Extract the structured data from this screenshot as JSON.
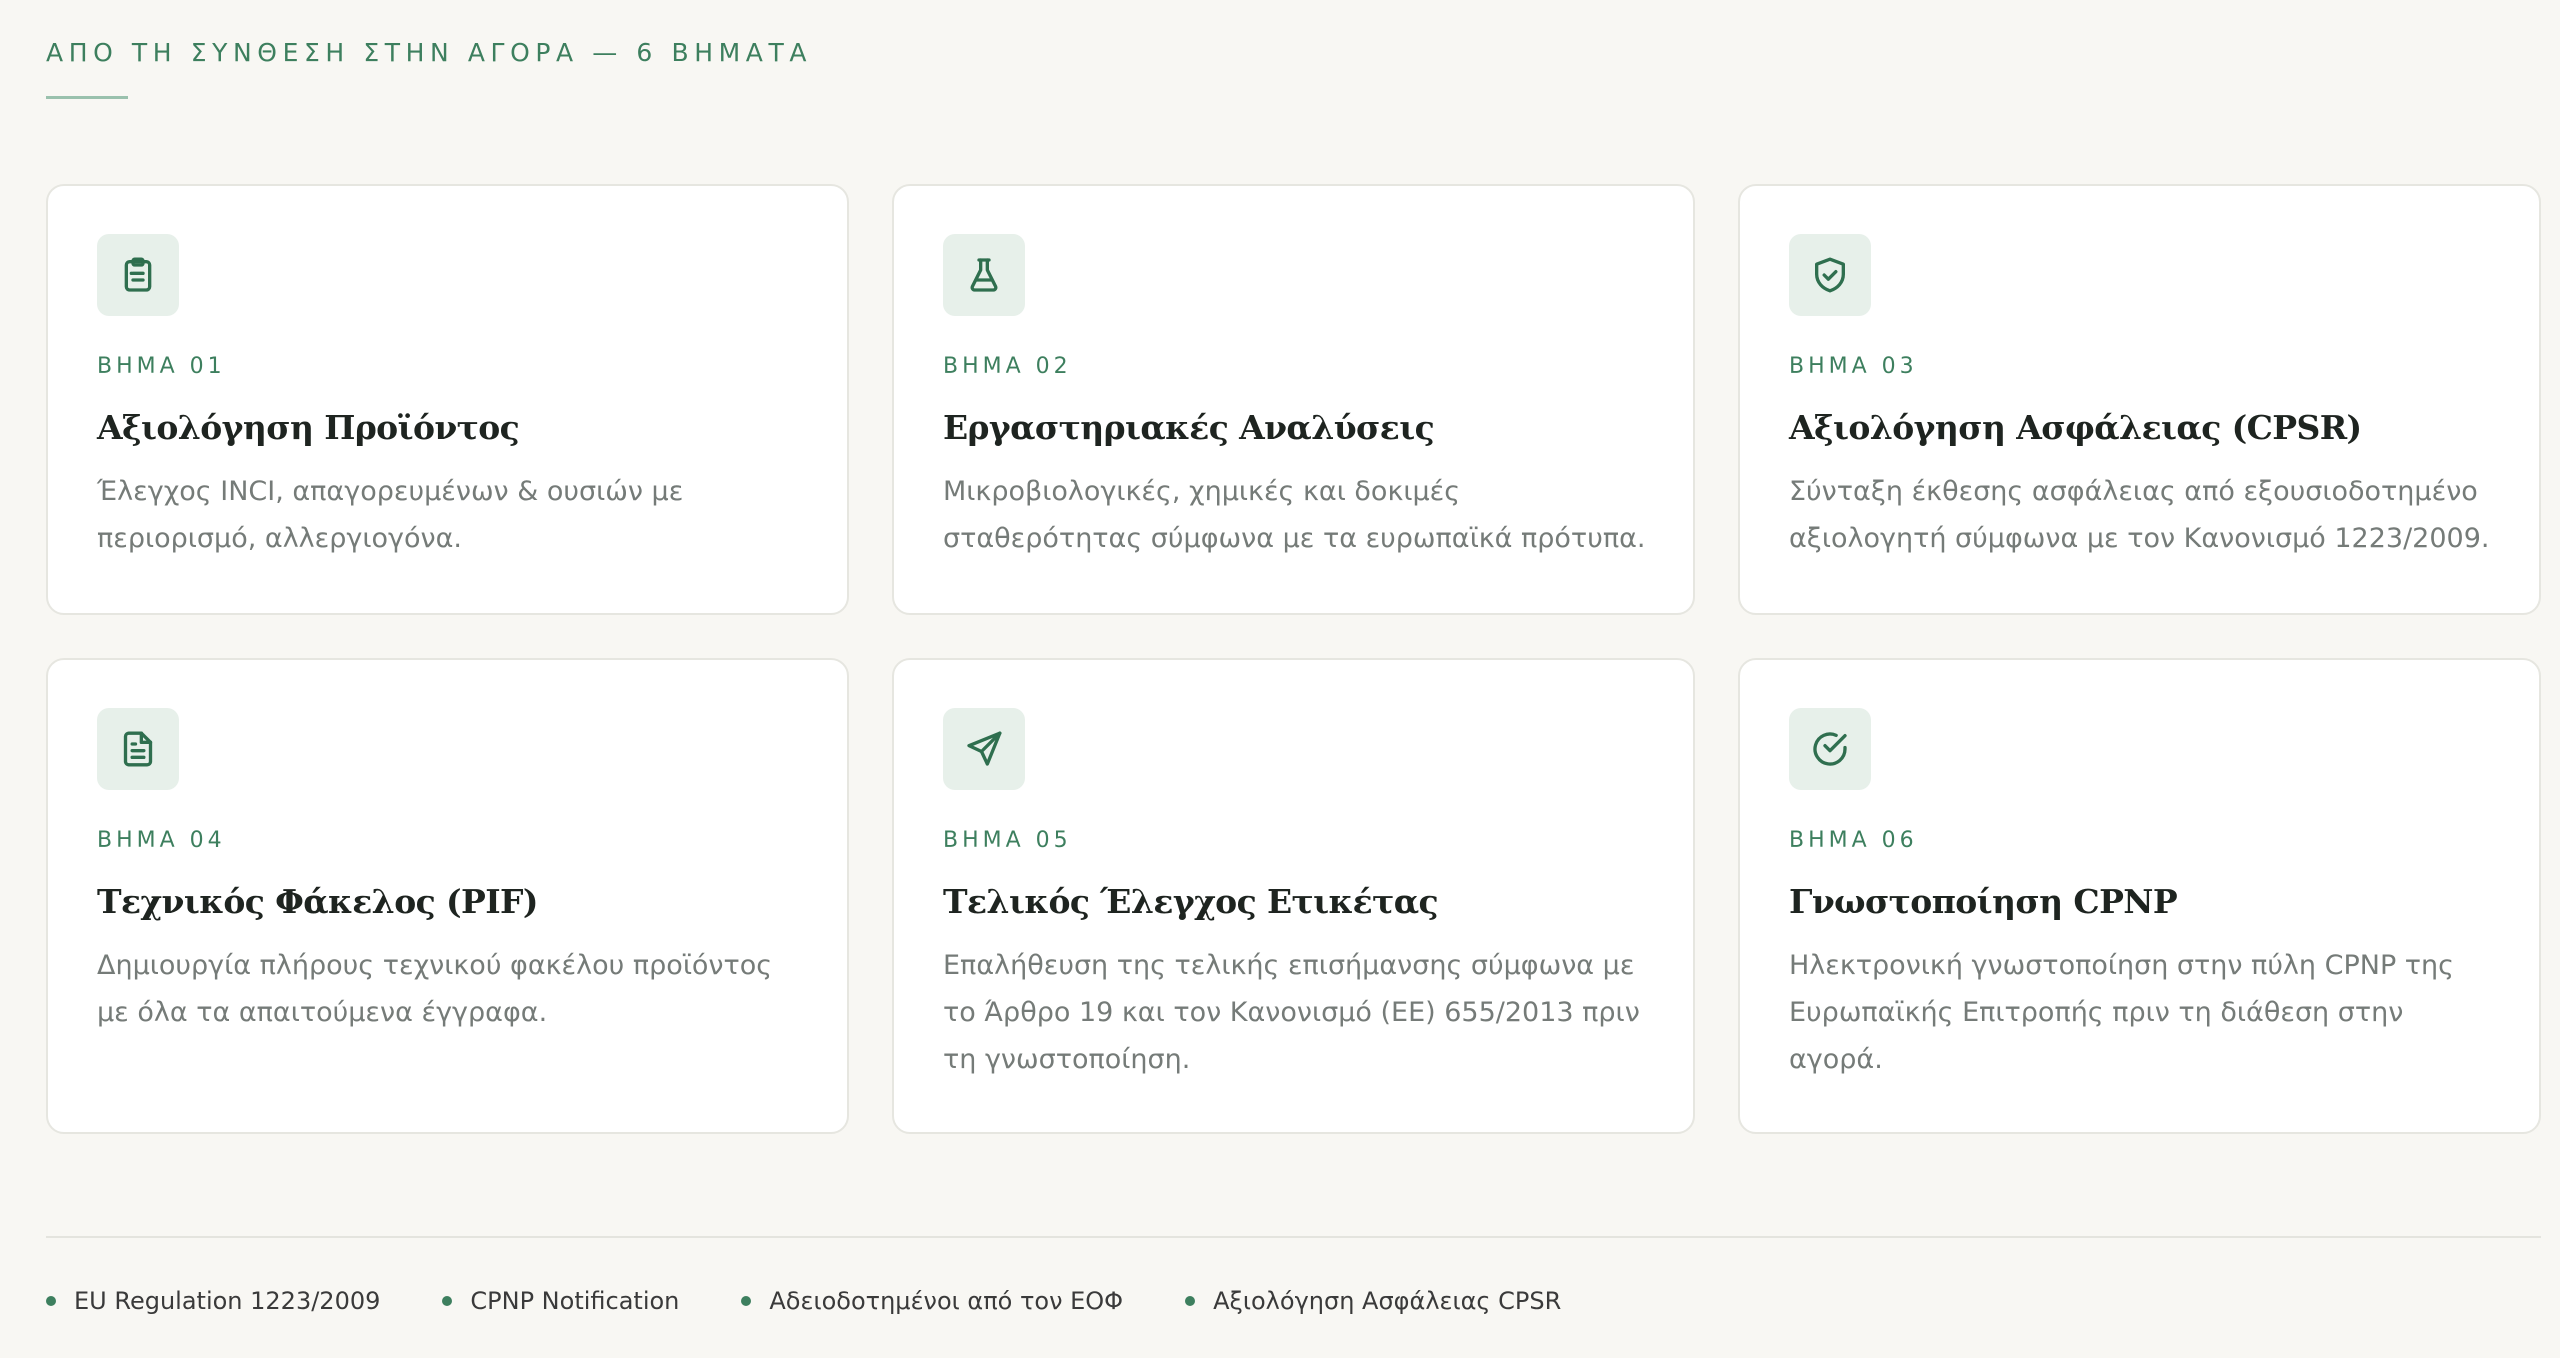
{
  "section": {
    "eyebrow": "ΑΠΟ ΤΗ ΣΥΝΘΕΣΗ ΣΤΗΝ ΑΓΟΡΑ — 6 ΒΗΜΑΤΑ"
  },
  "colors": {
    "accent": "#3d7f5e",
    "icon_bg": "#e7f0ea",
    "page_bg": "#f8f7f3",
    "card_bg": "#ffffff"
  },
  "steps": [
    {
      "icon": "clipboard-list-icon",
      "label": "ΒΗΜΑ 01",
      "title": "Αξιολόγηση Προϊόντος",
      "description": "Έλεγχος INCI, απαγορευμένων & ουσιών με περιορισμό, αλλεργιογόνα."
    },
    {
      "icon": "flask-icon",
      "label": "ΒΗΜΑ 02",
      "title": "Εργαστηριακές Αναλύσεις",
      "description": "Μικροβιολογικές, χημικές και δοκιμές σταθερότητας σύμφωνα με τα ευρωπαϊκά πρότυπα."
    },
    {
      "icon": "shield-check-icon",
      "label": "ΒΗΜΑ 03",
      "title": "Αξιολόγηση Ασφάλειας (CPSR)",
      "description": "Σύνταξη έκθεσης ασφάλειας από εξουσιοδοτημένο αξιολογητή σύμφωνα με τον Κανονισμό 1223/2009."
    },
    {
      "icon": "file-text-icon",
      "label": "ΒΗΜΑ 04",
      "title": "Τεχνικός Φάκελος (PIF)",
      "description": "Δημιουργία πλήρους τεχνικού φακέλου προϊόντος με όλα τα απαιτούμενα έγγραφα."
    },
    {
      "icon": "send-icon",
      "label": "ΒΗΜΑ 05",
      "title": "Τελικός Έλεγχος Ετικέτας",
      "description": "Επαλήθευση της τελικής επισήμανσης σύμφωνα με το Άρθρο 19 και τον Κανονισμό (ΕΕ) 655/2013 πριν τη γνωστοποίηση."
    },
    {
      "icon": "check-circle-icon",
      "label": "ΒΗΜΑ 06",
      "title": "Γνωστοποίηση CPNP",
      "description": "Ηλεκτρονική γνωστοποίηση στην πύλη CPNP της Ευρωπαϊκής Επιτροπής πριν τη διάθεση στην αγορά."
    }
  ],
  "badges": [
    "EU Regulation 1223/2009",
    "CPNP Notification",
    "Αδειοδοτημένοι από τον ΕΟΦ",
    "Αξιολόγηση Ασφάλειας CPSR"
  ]
}
